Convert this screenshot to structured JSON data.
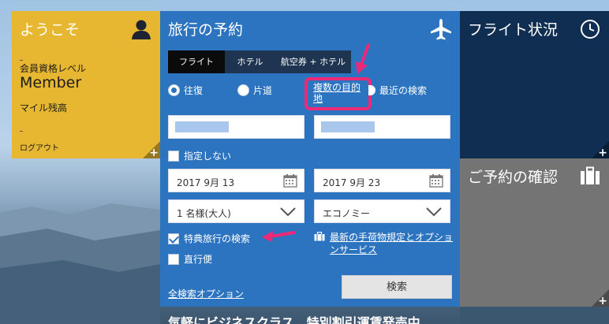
{
  "welcome": {
    "title": "ようこそ",
    "level_label": "会員資格レベル",
    "level": "Member",
    "miles_label": "マイル残高",
    "logout": "ログアウト",
    "plus": "+"
  },
  "booking": {
    "title": "旅行の予約",
    "tabs": [
      {
        "label": "フライト",
        "active": true
      },
      {
        "label": "ホテル",
        "active": false
      },
      {
        "label": "航空券 + ホテル",
        "active": false
      }
    ],
    "trip_types": [
      {
        "label": "往復",
        "checked": true
      },
      {
        "label": "片道",
        "checked": false
      }
    ],
    "multi_city": "複数の目的地",
    "recent_search": "最近の検索",
    "no_specify": "指定しない",
    "depart_date": "2017 9月 13",
    "return_date": "2017 9月 23",
    "passengers": "1 名様(大人)",
    "cabin": "エコノミー",
    "award_search": "特典旅行の検索",
    "direct_flights": "直行便",
    "baggage_link": "最新の手荷物規定とオプションサービス",
    "all_options": "全検索オプション",
    "search_button": "検索"
  },
  "flight_status": {
    "title": "フライト状況",
    "plus": "+"
  },
  "reservation": {
    "title": "ご予約の確認",
    "plus": "+"
  },
  "banner": {
    "text": "気軽にビジネスクラス　特別割引運賃発売中"
  },
  "colors": {
    "welcome_tile": "#e7b731",
    "booking_panel": "#2c74c0",
    "status_tile": "#0f2e52",
    "confirm_tile": "#747474",
    "annotation": "#ec2a77"
  }
}
